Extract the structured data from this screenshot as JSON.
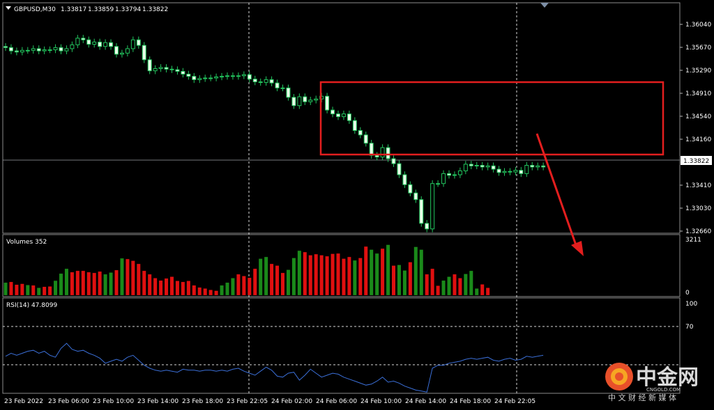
{
  "header": {
    "symbol": "GBPUSD,M30",
    "ohlc": [
      "1.33817",
      "1.33859",
      "1.33794",
      "1.33822"
    ]
  },
  "price_axis": {
    "ticks": [
      "1.36040",
      "1.35670",
      "1.35290",
      "1.34910",
      "1.34540",
      "1.34160",
      "1.33410",
      "1.33030",
      "1.32660"
    ],
    "current_price": "1.33822"
  },
  "volume_panel": {
    "title": "Volumes 352",
    "max_label": "3211",
    "min_label": "0"
  },
  "rsi_panel": {
    "title": "RSI(14) 47.8099",
    "levels": [
      "100",
      "70",
      "30"
    ]
  },
  "time_axis": [
    "23 Feb 2022",
    "23 Feb 06:00",
    "23 Feb 10:00",
    "23 Feb 14:00",
    "23 Feb 18:00",
    "23 Feb 22:05",
    "24 Feb 02:00",
    "24 Feb 06:00",
    "24 Feb 10:00",
    "24 Feb 14:00",
    "24 Feb 18:00",
    "24 Feb 22:05"
  ],
  "watermark": {
    "brand": "中金网",
    "domain": "CNGOLD.COM",
    "tagline": "中 文 财 经 新 媒 体"
  },
  "colors": {
    "bull": "#22c55e",
    "bear": "#ff1a1a",
    "vol_up": "#1a8a1a",
    "vol_down": "#e01010",
    "rsi": "#3b6fd8",
    "box": "#e31e1e",
    "arrow": "#e31e1e"
  },
  "chart_data": [
    {
      "type": "candlestick",
      "symbol": "GBPUSD",
      "timeframe": "M30",
      "ylim": [
        1.3266,
        1.364
      ],
      "close": [
        1.3598,
        1.3592,
        1.359,
        1.3593,
        1.3593,
        1.3596,
        1.3592,
        1.3594,
        1.3594,
        1.3598,
        1.3592,
        1.3596,
        1.3603,
        1.3615,
        1.3612,
        1.3604,
        1.3608,
        1.36,
        1.3607,
        1.36,
        1.3586,
        1.3588,
        1.3596,
        1.3612,
        1.3602,
        1.3576,
        1.3556,
        1.356,
        1.3562,
        1.3559,
        1.3558,
        1.3555,
        1.355,
        1.3546,
        1.354,
        1.3542,
        1.3543,
        1.3543,
        1.3545,
        1.3546,
        1.3547,
        1.3546,
        1.3547,
        1.3549,
        1.3541,
        1.3536,
        1.3535,
        1.354,
        1.3534,
        1.3525,
        1.3525,
        1.3508,
        1.3493,
        1.3509,
        1.35,
        1.3503,
        1.3505,
        1.351,
        1.3485,
        1.3478,
        1.3473,
        1.3478,
        1.3466,
        1.3448,
        1.344,
        1.3425,
        1.3403,
        1.34,
        1.3417,
        1.3397,
        1.3388,
        1.3368,
        1.335,
        1.3335,
        1.3323,
        1.328,
        1.327,
        1.3352,
        1.3352,
        1.337,
        1.3367,
        1.3368,
        1.3375,
        1.3387,
        1.3384,
        1.3385,
        1.3382,
        1.3384,
        1.3378,
        1.3372,
        1.3374,
        1.3373,
        1.3376,
        1.337,
        1.3385,
        1.3382,
        1.3384,
        1.3382
      ]
    },
    {
      "type": "bar",
      "title": "Volumes",
      "ylim": [
        0,
        3211
      ],
      "values": [
        720,
        760,
        600,
        650,
        580,
        560,
        420,
        480,
        500,
        830,
        1240,
        1520,
        1320,
        1400,
        1400,
        1320,
        1280,
        1360,
        1200,
        1300,
        1440,
        2120,
        2080,
        1980,
        1800,
        1400,
        1200,
        980,
        840,
        960,
        1060,
        820,
        760,
        820,
        560,
        440,
        380,
        300,
        250,
        560,
        720,
        980,
        1200,
        1100,
        1000,
        1520,
        2100,
        2200,
        1800,
        1700,
        1280,
        1460,
        2140,
        2560,
        2480,
        2300,
        2360,
        2300,
        2240,
        2380,
        2400,
        2100,
        2200,
        2000,
        2140,
        2800,
        2620,
        2400,
        2680,
        2900,
        1700,
        1740,
        1420,
        1900,
        2780,
        2620,
        1200,
        1520,
        540,
        840,
        1060,
        1200,
        980,
        1220,
        1400,
        380,
        620,
        420
      ],
      "up": [
        true,
        false,
        false,
        false,
        true,
        false,
        true,
        false,
        false,
        true,
        true,
        true,
        false,
        false,
        false,
        false,
        false,
        false,
        true,
        true,
        false,
        true,
        false,
        false,
        false,
        false,
        false,
        false,
        false,
        false,
        false,
        false,
        false,
        false,
        false,
        false,
        false,
        false,
        false,
        true,
        true,
        true,
        false,
        false,
        false,
        false,
        true,
        true,
        false,
        false,
        false,
        true,
        true,
        true,
        false,
        false,
        false,
        false,
        false,
        false,
        false,
        false,
        false,
        true,
        false,
        false,
        true,
        true,
        false,
        true,
        false,
        true,
        true,
        false,
        true,
        true,
        false,
        false,
        false,
        true,
        true,
        false,
        false,
        true,
        true,
        true,
        false,
        false
      ]
    },
    {
      "type": "line",
      "title": "RSI(14)",
      "ylim": [
        0,
        100
      ],
      "levels": [
        70,
        30
      ],
      "values": [
        47,
        50,
        48,
        50,
        52,
        53,
        50,
        52,
        48,
        46,
        55,
        60,
        54,
        52,
        53,
        50,
        48,
        45,
        40,
        42,
        44,
        42,
        46,
        48,
        43,
        38,
        35,
        33,
        32,
        33,
        32,
        31,
        34,
        33,
        33,
        32,
        33,
        33,
        32,
        33,
        32,
        34,
        35,
        32,
        30,
        28,
        32,
        36,
        33,
        27,
        26,
        30,
        31,
        23,
        28,
        34,
        30,
        26,
        28,
        30,
        29,
        26,
        24,
        22,
        20,
        18,
        19,
        22,
        26,
        21,
        22,
        20,
        17,
        15,
        13,
        12,
        11,
        35,
        38,
        38,
        40,
        41,
        42,
        44,
        45,
        44,
        45,
        46,
        43,
        42,
        44,
        45,
        43,
        44,
        47,
        46,
        47,
        48
      ]
    }
  ]
}
